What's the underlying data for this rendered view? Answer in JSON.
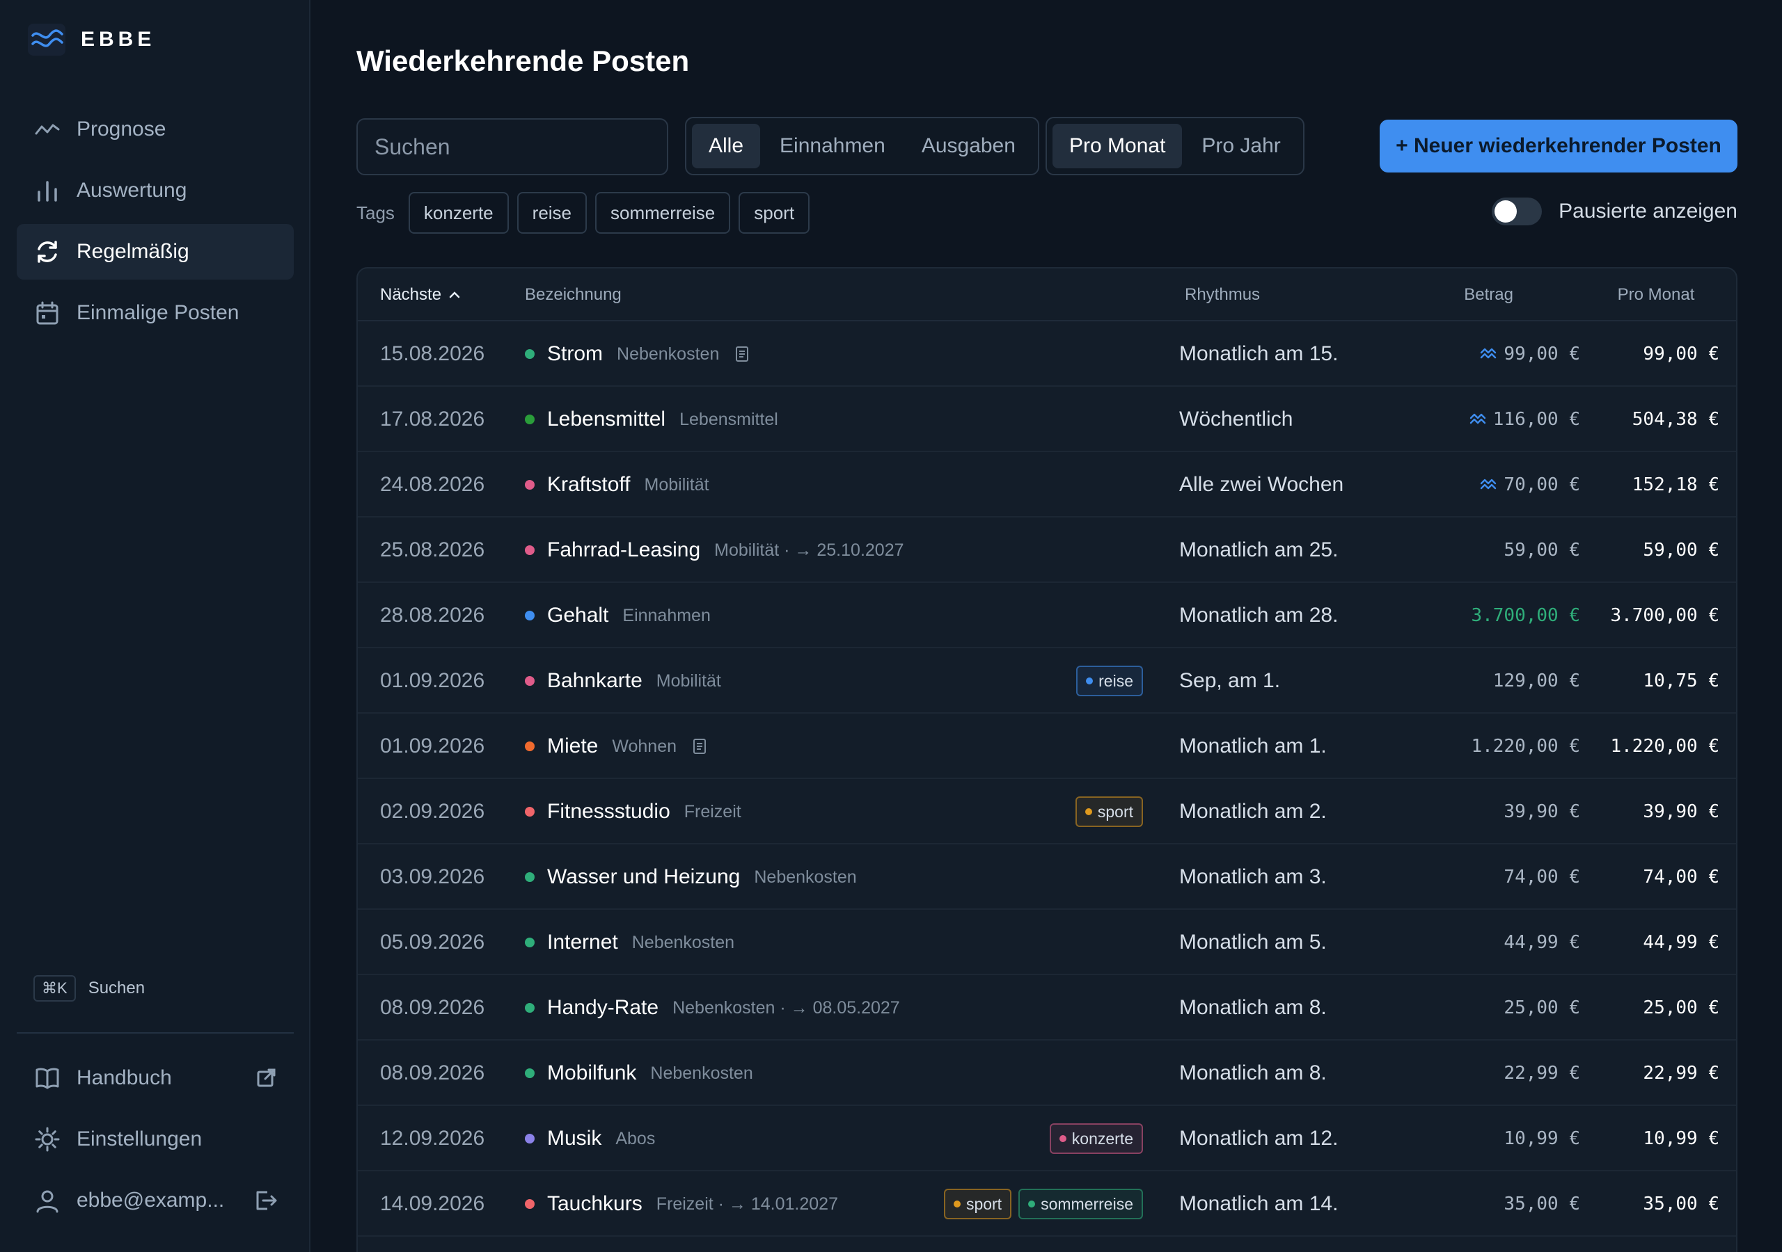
{
  "brand": {
    "name": "EBBE"
  },
  "nav": [
    {
      "label": "Prognose",
      "icon": "trend-icon"
    },
    {
      "label": "Auswertung",
      "icon": "bar-chart-icon"
    },
    {
      "label": "Regelmäßig",
      "icon": "refresh-icon",
      "active": true
    },
    {
      "label": "Einmalige Posten",
      "icon": "calendar-icon"
    }
  ],
  "sidebar_search": {
    "shortcut": "⌘K",
    "label": "Suchen"
  },
  "bottom_nav": {
    "manual": "Handbuch",
    "settings": "Einstellungen",
    "account": "ebbe@examp..."
  },
  "page": {
    "title": "Wiederkehrende Posten"
  },
  "search": {
    "placeholder": "Suchen"
  },
  "type_filter": [
    "Alle",
    "Einnahmen",
    "Ausgaben"
  ],
  "type_filter_active": 0,
  "period_filter": [
    "Pro Monat",
    "Pro Jahr"
  ],
  "period_filter_active": 0,
  "new_button": "+ Neuer wiederkehrender Posten",
  "tags": {
    "label": "Tags",
    "items": [
      "konzerte",
      "reise",
      "sommerreise",
      "sport"
    ]
  },
  "paused_toggle": {
    "label": "Pausierte anzeigen",
    "on": false
  },
  "table": {
    "headers": {
      "next": "Nächste",
      "name": "Bezeichnung",
      "rhythm": "Rhythmus",
      "amount": "Betrag",
      "monthly": "Pro Monat"
    },
    "rows": [
      {
        "date": "15.08.2026",
        "name": "Strom",
        "category": "Nebenkosten",
        "dot": "#2fae7a",
        "note": true,
        "tags": [],
        "rhythm": "Monatlich am 15.",
        "amount": "99,00 €",
        "variable": true,
        "monthly": "99,00 €"
      },
      {
        "date": "17.08.2026",
        "name": "Lebensmittel",
        "category": "Lebensmittel",
        "dot": "#2a9d3a",
        "tags": [],
        "rhythm": "Wöchentlich",
        "amount": "116,00 €",
        "variable": true,
        "monthly": "504,38 €"
      },
      {
        "date": "24.08.2026",
        "name": "Kraftstoff",
        "category": "Mobilität",
        "dot": "#e05c8a",
        "tags": [],
        "rhythm": "Alle zwei Wochen",
        "amount": "70,00 €",
        "variable": true,
        "monthly": "152,18 €"
      },
      {
        "date": "25.08.2026",
        "name": "Fahrrad-Leasing",
        "category": "Mobilität · → 25.10.2027",
        "dot": "#e05c8a",
        "tags": [],
        "rhythm": "Monatlich am 25.",
        "amount": "59,00 €",
        "monthly": "59,00 €"
      },
      {
        "date": "28.08.2026",
        "name": "Gehalt",
        "category": "Einnahmen",
        "dot": "#3f8ef0",
        "tags": [],
        "rhythm": "Monatlich am 28.",
        "amount": "3.700,00 €",
        "income": true,
        "monthly": "3.700,00 €"
      },
      {
        "date": "01.09.2026",
        "name": "Bahnkarte",
        "category": "Mobilität",
        "dot": "#e05c8a",
        "tags": [
          {
            "label": "reise",
            "color": "#3f8ef0"
          }
        ],
        "rhythm": "Sep, am 1.",
        "amount": "129,00 €",
        "monthly": "10,75 €"
      },
      {
        "date": "01.09.2026",
        "name": "Miete",
        "category": "Wohnen",
        "dot": "#f06a2e",
        "note": true,
        "tags": [],
        "rhythm": "Monatlich am 1.",
        "amount": "1.220,00 €",
        "monthly": "1.220,00 €"
      },
      {
        "date": "02.09.2026",
        "name": "Fitnessstudio",
        "category": "Freizeit",
        "dot": "#f0656a",
        "tags": [
          {
            "label": "sport",
            "color": "#e09a1e"
          }
        ],
        "rhythm": "Monatlich am 2.",
        "amount": "39,90 €",
        "monthly": "39,90 €"
      },
      {
        "date": "03.09.2026",
        "name": "Wasser und Heizung",
        "category": "Nebenkosten",
        "dot": "#2fae7a",
        "tags": [],
        "rhythm": "Monatlich am 3.",
        "amount": "74,00 €",
        "monthly": "74,00 €"
      },
      {
        "date": "05.09.2026",
        "name": "Internet",
        "category": "Nebenkosten",
        "dot": "#2fae7a",
        "tags": [],
        "rhythm": "Monatlich am 5.",
        "amount": "44,99 €",
        "monthly": "44,99 €"
      },
      {
        "date": "08.09.2026",
        "name": "Handy-Rate",
        "category": "Nebenkosten · → 08.05.2027",
        "dot": "#2fae7a",
        "tags": [],
        "rhythm": "Monatlich am 8.",
        "amount": "25,00 €",
        "monthly": "25,00 €"
      },
      {
        "date": "08.09.2026",
        "name": "Mobilfunk",
        "category": "Nebenkosten",
        "dot": "#2fae7a",
        "tags": [],
        "rhythm": "Monatlich am 8.",
        "amount": "22,99 €",
        "monthly": "22,99 €"
      },
      {
        "date": "12.09.2026",
        "name": "Musik",
        "category": "Abos",
        "dot": "#8b82e8",
        "tags": [
          {
            "label": "konzerte",
            "color": "#e05c8a"
          }
        ],
        "rhythm": "Monatlich am 12.",
        "amount": "10,99 €",
        "monthly": "10,99 €"
      },
      {
        "date": "14.09.2026",
        "name": "Tauchkurs",
        "category": "Freizeit · → 14.01.2027",
        "dot": "#f0656a",
        "tags": [
          {
            "label": "sport",
            "color": "#e09a1e"
          },
          {
            "label": "sommerreise",
            "color": "#2fae7a"
          }
        ],
        "rhythm": "Monatlich am 14.",
        "amount": "35,00 €",
        "monthly": "35,00 €"
      }
    ]
  }
}
